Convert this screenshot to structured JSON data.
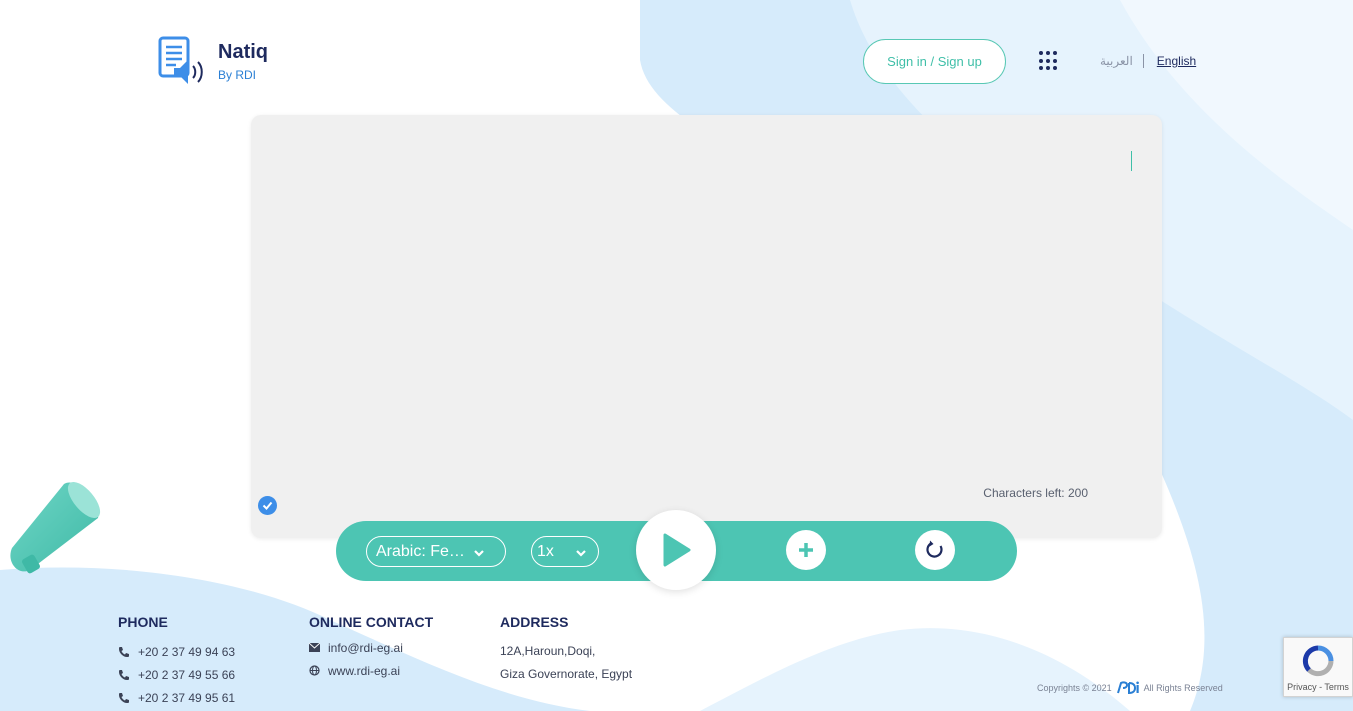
{
  "header": {
    "brand": "Natiq",
    "brand_sub": "By RDI",
    "signin_label": "Sign in / Sign up",
    "lang_ar": "العربية",
    "lang_en": "English"
  },
  "editor": {
    "chars_left": "Characters left: 200"
  },
  "controls": {
    "voice_selected": "Arabic: Female",
    "speed_selected": "1x"
  },
  "footer": {
    "phone_heading": "PHONE",
    "phones": [
      "+20 2 37 49 94 63",
      "+20 2 37 49 55 66",
      "+20 2 37 49 95 61"
    ],
    "contact_heading": "ONLINE CONTACT",
    "email": "info@rdi-eg.ai",
    "website": "www.rdi-eg.ai",
    "address_heading": "ADDRESS",
    "address_line1": "12A,Haroun,Doqi,",
    "address_line2": "Giza Governorate, Egypt",
    "copyright_prefix": "Copyrights © 2021",
    "copyright_suffix": "All Rights Reserved"
  },
  "recaptcha": {
    "links": "Privacy - Terms"
  },
  "colors": {
    "accent": "#4dc5b3",
    "navy": "#1e2a5e",
    "blue": "#3d8ee8"
  }
}
